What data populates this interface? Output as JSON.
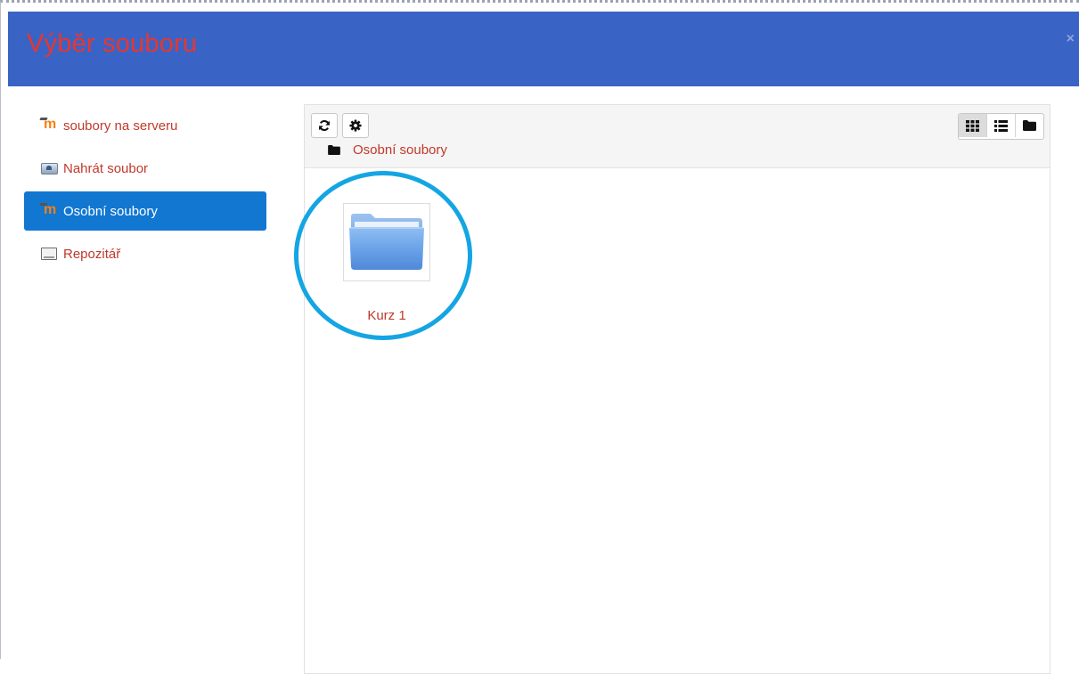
{
  "dialog": {
    "title": "Výběr souboru",
    "close_icon": "close-icon",
    "colors": {
      "header_bg": "#3a63c6",
      "title": "#e8362d",
      "active_bg": "#1177d1",
      "link": "#c0392b",
      "highlight": "#14a5e3"
    }
  },
  "sidebar": {
    "items": [
      {
        "label": "soubory na serveru",
        "icon": "moodle-icon",
        "active": false
      },
      {
        "label": "Nahrát soubor",
        "icon": "upload-icon",
        "active": false
      },
      {
        "label": "Osobní soubory",
        "icon": "moodle-icon",
        "active": true
      },
      {
        "label": "Repozitář",
        "icon": "repository-icon",
        "active": false
      }
    ]
  },
  "toolbar": {
    "refresh_icon": "refresh-icon",
    "settings_icon": "gear-icon",
    "view_modes": [
      {
        "name": "icons",
        "icon": "grid-icon",
        "active": true
      },
      {
        "name": "details",
        "icon": "list-icon",
        "active": false
      },
      {
        "name": "tree",
        "icon": "folder-icon",
        "active": false
      }
    ]
  },
  "breadcrumb": {
    "icon": "folder-icon",
    "label": "Osobní soubory"
  },
  "files": [
    {
      "label": "Kurz 1",
      "icon": "folder-icon"
    }
  ]
}
